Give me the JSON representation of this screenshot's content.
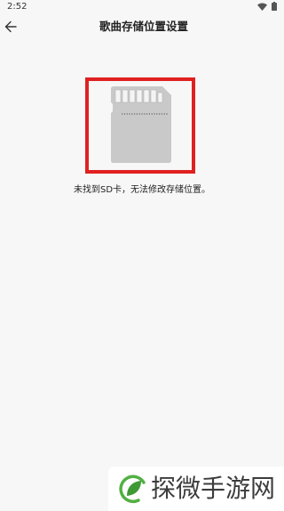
{
  "status_bar": {
    "time": "2:52"
  },
  "header": {
    "title": "歌曲存储位置设置"
  },
  "main": {
    "message": "未找到SD卡，无法修改存储位置。"
  },
  "watermark": {
    "text": "探微手游网"
  },
  "icons": {
    "back": "arrow-left-icon",
    "wifi": "wifi-icon",
    "battery": "battery-icon",
    "sd_card": "sd-card-icon",
    "watermark_logo": "leaf-logo-icon"
  },
  "colors": {
    "background": "#f7f7f7",
    "highlight_frame": "#e02020",
    "sd_card": "#c9c9c9",
    "watermark_green": "#52b043"
  }
}
